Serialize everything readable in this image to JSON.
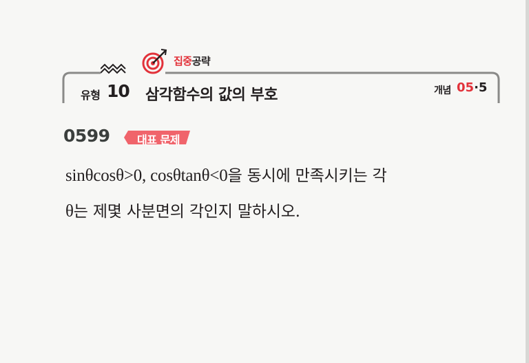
{
  "brand": {
    "part1": "집중",
    "part2": "공략"
  },
  "section": {
    "type_label": "유형",
    "type_number": "10",
    "title": "삼각함수의 값의 부호",
    "concept_label": "개념",
    "concept_ref_main": "05",
    "concept_ref_sub": "·5"
  },
  "problem": {
    "number": "0599",
    "badge": "대표 문제",
    "line1_math": "sinθcosθ>0, cosθtanθ<0",
    "line1_text": "을 동시에 만족시키는 각",
    "line2_math": "θ",
    "line2_text": "는 제몇 사분면의 각인지 말하시오."
  },
  "colors": {
    "accent_red": "#e2323a",
    "badge_pink": "#f0646b",
    "frame_gray": "#8a8a88",
    "number_dark": "#3b3f3d"
  },
  "icons": {
    "target": "target-icon",
    "zigzag": "zigzag-icon"
  }
}
